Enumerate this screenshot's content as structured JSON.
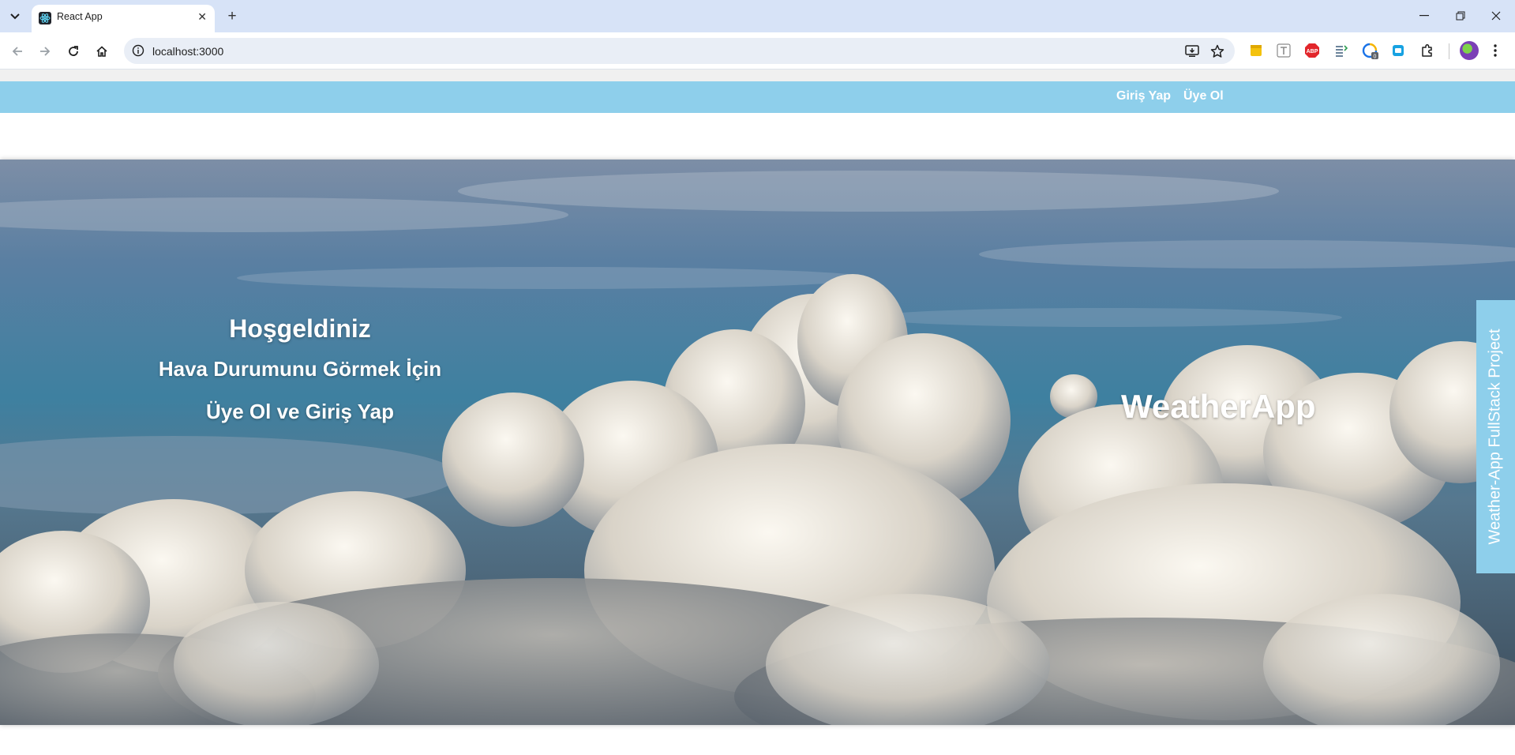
{
  "browser": {
    "tab_title": "React App",
    "url": "localhost:3000",
    "colors": {
      "tabstrip": "#d7e3f7",
      "omnibox": "#e9eef6"
    },
    "extensions": [
      "notes-extension-icon",
      "text-extension-icon",
      "adblock-extension-icon",
      "list-extension-icon",
      "loader-extension-icon",
      "screen-extension-icon",
      "puzzle-icon"
    ],
    "adblock_label": "ABP",
    "loader_badge": "0"
  },
  "navbar": {
    "login": "Giriş Yap",
    "signup": "Üye Ol",
    "color": "#8ecfeb"
  },
  "hero": {
    "welcome_title": "Hoşgeldiniz",
    "line1": "Hava Durumunu Görmek İçin",
    "line2": "Üye Ol ve Giriş Yap",
    "brand": "WeatherApp"
  },
  "side_tab": {
    "label": "Weather-App FullStack Project",
    "color": "#8ecfeb"
  }
}
